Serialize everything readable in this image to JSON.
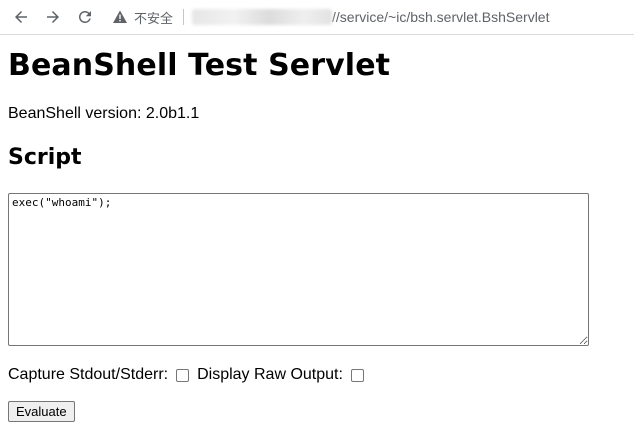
{
  "browser": {
    "security_label": "不安全",
    "url_visible": "//service/~ic/bsh.servlet.BshServlet"
  },
  "page": {
    "title": "BeanShell Test Servlet",
    "version_text": "BeanShell version: 2.0b1.1",
    "script_heading": "Script",
    "script_value": "exec(\"whoami\");",
    "capture_label": "Capture Stdout/Stderr:",
    "capture_checked": false,
    "raw_output_label": "Display Raw Output:",
    "raw_output_checked": false,
    "evaluate_label": "Evaluate"
  }
}
